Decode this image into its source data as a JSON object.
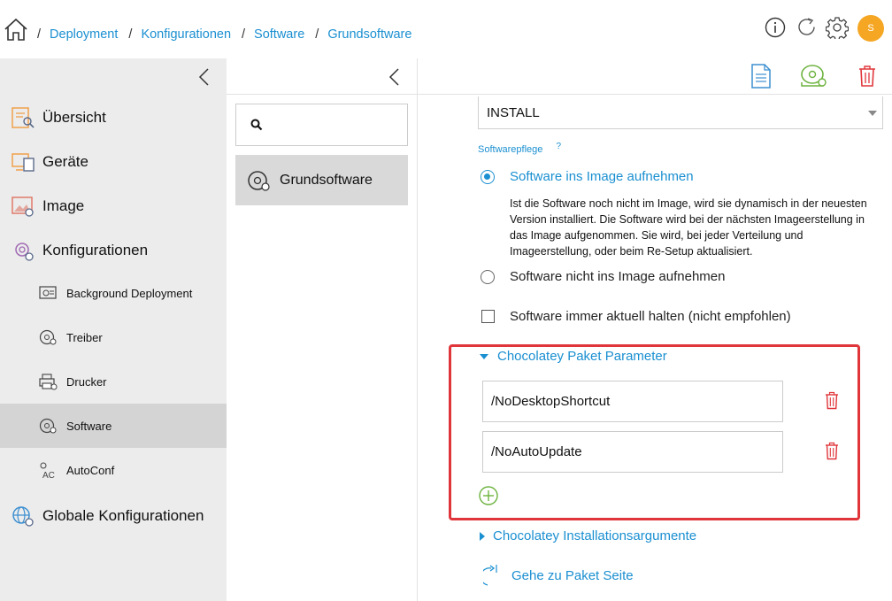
{
  "breadcrumb": {
    "items": [
      "Deployment",
      "Konfigurationen",
      "Software",
      "Grundsoftware"
    ],
    "separator": "/"
  },
  "user": {
    "avatar_initial": "S",
    "avatar_color": "#f5a623"
  },
  "colors": {
    "accent": "#1a8fd1",
    "danger": "#e0363b",
    "add": "#6db33f",
    "icon_orange": "#f0a04b"
  },
  "sidebar": {
    "items": [
      {
        "label": "Übersicht",
        "icon": "overview-icon"
      },
      {
        "label": "Geräte",
        "icon": "devices-icon"
      },
      {
        "label": "Image",
        "icon": "image-icon"
      },
      {
        "label": "Konfigurationen",
        "icon": "configurations-icon"
      },
      {
        "label": "Background Deployment",
        "icon": "background-deployment-icon"
      },
      {
        "label": "Treiber",
        "icon": "driver-icon"
      },
      {
        "label": "Drucker",
        "icon": "printer-icon"
      },
      {
        "label": "Software",
        "icon": "software-disc-icon"
      },
      {
        "label": "AutoConf",
        "icon": "autoconf-icon"
      },
      {
        "label": "Globale Konfigurationen",
        "icon": "global-config-icon"
      }
    ],
    "active": "Software"
  },
  "mid": {
    "search_placeholder": "",
    "items": [
      {
        "label": "Grundsoftware",
        "icon": "software-disc-icon"
      }
    ]
  },
  "form": {
    "install_select": "INSTALL",
    "section_label": "Softwarepflege",
    "section_help": "?",
    "option1_label": "Software ins Image aufnehmen",
    "option1_desc": "Ist die Software noch nicht im Image, wird sie dynamisch in der neuesten Version installiert. Die Software wird bei der nächsten Imageerstellung in das Image aufgenommen. Sie wird, bei jeder Verteilung und Imageerstellung, oder beim Re-Setup aktualisiert.",
    "option2_label": "Software nicht ins Image aufnehmen",
    "checkbox_label": "Software immer aktuell halten (nicht empfohlen)",
    "selected_option": "option1",
    "checkbox_checked": false
  },
  "chocolatey": {
    "params_title": "Chocolatey Paket Parameter",
    "params": [
      "/NoDesktopShortcut",
      "/NoAutoUpdate"
    ],
    "args_title": "Chocolatey Installationsargumente",
    "goto_label": "Gehe zu Paket Seite"
  }
}
